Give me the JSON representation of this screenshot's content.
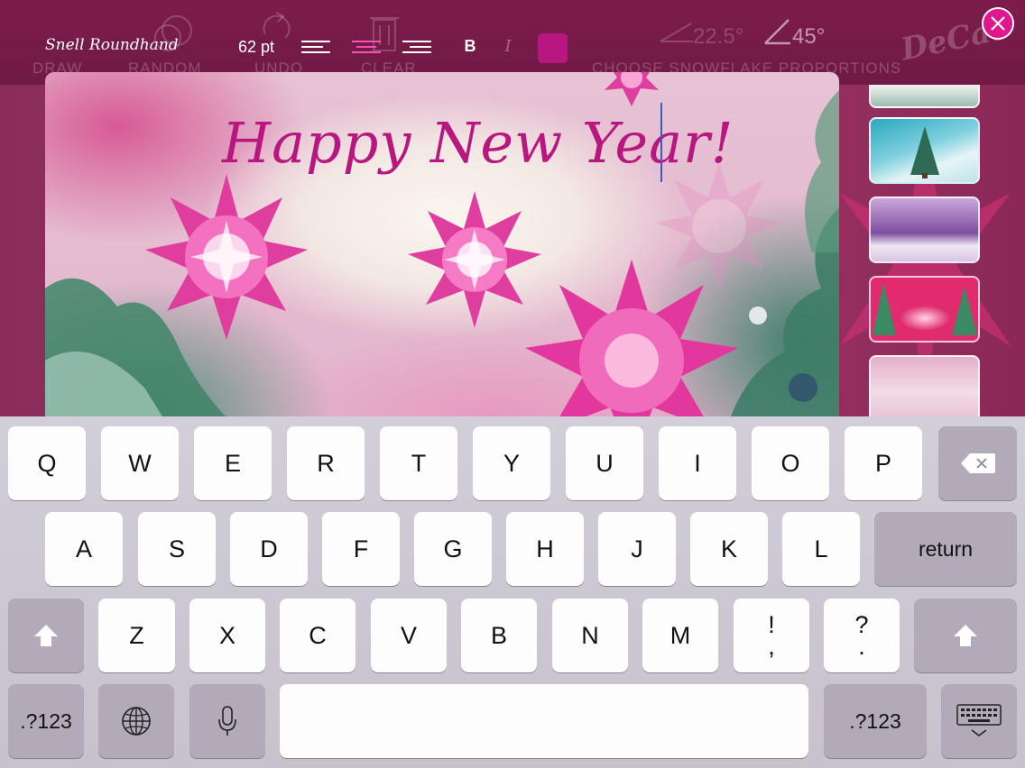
{
  "toolbar": {
    "font_name": "Snell Roundhand",
    "font_size": "62 pt",
    "bold_label": "B",
    "italic_label": "I",
    "text_color": "#b8177f",
    "selected_alignment": "center",
    "ghost_labels": {
      "draw": "DRAW",
      "random": "RANDOM",
      "undo": "UNDO",
      "clear": "CLEAR",
      "proportions": "CHOOSE SNOWFLAKE PROPORTIONS"
    },
    "angle_left": "22.5°",
    "angle_right": "45°",
    "logo_text": "DeCat"
  },
  "card": {
    "text": "Happy New Year!"
  },
  "thumbnails": [
    {
      "name": "snowy-field",
      "colors": [
        "#c9d3cf",
        "#9db3ac"
      ]
    },
    {
      "name": "teal-tree",
      "colors": [
        "#2fb2c6",
        "#bfe8ee"
      ]
    },
    {
      "name": "purple-snow",
      "colors": [
        "#8a5fa6",
        "#e9dff0"
      ]
    },
    {
      "name": "pink-forest",
      "colors": [
        "#d6306f",
        "#3f8467"
      ]
    },
    {
      "name": "pink-trees",
      "colors": [
        "#e0a3bf",
        "#f1d9e5"
      ]
    }
  ],
  "keyboard": {
    "row1": [
      "Q",
      "W",
      "E",
      "R",
      "T",
      "Y",
      "U",
      "I",
      "O",
      "P"
    ],
    "row2": [
      "A",
      "S",
      "D",
      "F",
      "G",
      "H",
      "J",
      "K",
      "L"
    ],
    "row3": [
      "Z",
      "X",
      "C",
      "V",
      "B",
      "N",
      "M"
    ],
    "punct1": {
      "top": "!",
      "bottom": ","
    },
    "punct2": {
      "top": "?",
      "bottom": "."
    },
    "return_label": "return",
    "numbers_label": ".?123"
  },
  "colors": {
    "accent": "#b8177f",
    "topbar": "#761b49",
    "close": "#e0168c"
  }
}
